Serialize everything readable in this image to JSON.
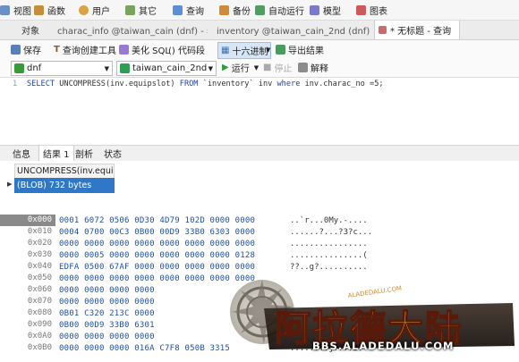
{
  "ribbon": [
    {
      "label": "视图",
      "icon": "view-icon",
      "color": "#6a8fc7"
    },
    {
      "label": "函数",
      "icon": "function-icon",
      "color": "#c58f3a"
    },
    {
      "label": "用户",
      "icon": "user-icon",
      "color": "#d9a441"
    },
    {
      "label": "其它",
      "icon": "other-icon",
      "color": "#7aa45b"
    },
    {
      "label": "查询",
      "icon": "query-icon",
      "color": "#5b8fd6"
    },
    {
      "label": "备份",
      "icon": "backup-icon",
      "color": "#d08a3a"
    },
    {
      "label": "自动运行",
      "icon": "schedule-icon",
      "color": "#4da060"
    },
    {
      "label": "模型",
      "icon": "model-icon",
      "color": "#7a7ac9"
    },
    {
      "label": "图表",
      "icon": "chart-icon",
      "color": "#cc5a5a"
    }
  ],
  "tabs": {
    "objects": "对象",
    "t1": "charac_info @taiwan_cain (dnf) - 表",
    "t2": "inventory @taiwan_cain_2nd (dnf) - 表",
    "t3": "* 无标题 - 查询"
  },
  "toolbar": {
    "save": "保存",
    "builder": "查询创建工具",
    "beautify": "美化 SQL",
    "snippet": "() 代码段",
    "hex": "十六进制",
    "export": "导出结果"
  },
  "toolbar2": {
    "connection": "dnf",
    "database": "taiwan_cain_2nd",
    "run": "运行",
    "stop": "停止",
    "explain": "解释"
  },
  "editor": {
    "line_no": "1",
    "sql": "SELECT UNCOMPRESS(inv.equipslot) FROM `inventory` inv where inv.charac_no =5;"
  },
  "result_tabs": [
    "信息",
    "结果 1",
    "剖析",
    "状态"
  ],
  "grid": {
    "column": "UNCOMPRESS(inv.equips",
    "value": "(BLOB) 732 bytes"
  },
  "hex_rows": [
    {
      "addr": "0x000",
      "bytes": "0001 6072 0506 0D30 4D79 102D 0000 0000",
      "ascii": "..`r...0My.-...."
    },
    {
      "addr": "0x010",
      "bytes": "0004 0700 00C3 0B00 00D9 33B0 6303 0000",
      "ascii": "......?...?3?c..."
    },
    {
      "addr": "0x020",
      "bytes": "0000 0000 0000 0000 0000 0000 0000 0000",
      "ascii": "................"
    },
    {
      "addr": "0x030",
      "bytes": "0000 0005 0000 0000 0000 0000 0000 0128",
      "ascii": "...............("
    },
    {
      "addr": "0x040",
      "bytes": "EDFA 0500 67AF 0000 0000 0000 0000 0000",
      "ascii": "??..g?.........."
    },
    {
      "addr": "0x050",
      "bytes": "0000 0000 0000 0000 0000 0000 0000 0000",
      "ascii": ""
    },
    {
      "addr": "0x060",
      "bytes": "0000 0000 0000 0000",
      "ascii": ""
    },
    {
      "addr": "0x070",
      "bytes": "0000 0000 0000 0000",
      "ascii": ""
    },
    {
      "addr": "0x080",
      "bytes": "0B01 C320 213C 0000",
      "ascii": ""
    },
    {
      "addr": "0x090",
      "bytes": "0B00 00D9 33B0 6301",
      "ascii": ""
    },
    {
      "addr": "0x0A0",
      "bytes": "0000 0000 0000 0000",
      "ascii": ""
    },
    {
      "addr": "0x0B0",
      "bytes": "0000 0000 0000 016A C7F8 050B 3315",
      "ascii": "........j??..3."
    }
  ],
  "watermark": {
    "logo_text": "阿拉德大陆",
    "url": "BBS.ALADEDALU.COM"
  }
}
